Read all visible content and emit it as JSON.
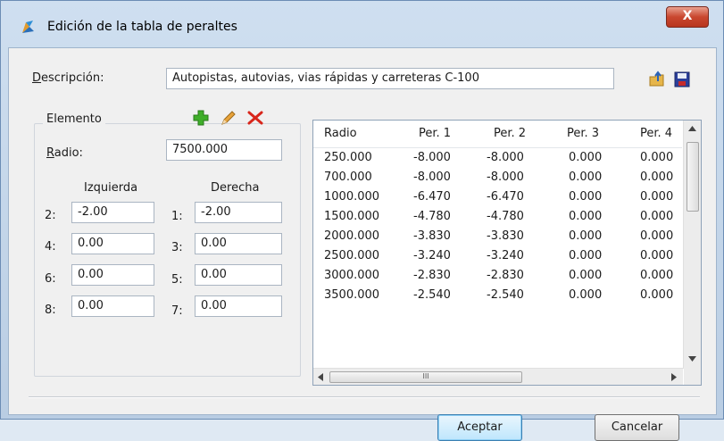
{
  "window": {
    "title": "Edición de la tabla de peraltes",
    "close_label": "X"
  },
  "descripcion": {
    "label_u": "D",
    "label_rest": "escripción:",
    "value": "Autopistas, autovias, vias rápidas y carreteras C-100"
  },
  "elemento": {
    "title": "Elemento",
    "radio_label_u": "R",
    "radio_label_rest": "adio:",
    "radio_value": "7500.000",
    "izquierda_label": "Izquierda",
    "derecha_label": "Derecha",
    "left": [
      {
        "label": "2:",
        "value": "-2.00"
      },
      {
        "label": "4:",
        "value": "0.00"
      },
      {
        "label": "6:",
        "value": "0.00"
      },
      {
        "label": "8:",
        "value": "0.00"
      }
    ],
    "right": [
      {
        "label": "1:",
        "value": "-2.00"
      },
      {
        "label": "3:",
        "value": "0.00"
      },
      {
        "label": "5:",
        "value": "0.00"
      },
      {
        "label": "7:",
        "value": "0.00"
      }
    ]
  },
  "table": {
    "headers": [
      "Radio",
      "Per. 1",
      "Per. 2",
      "Per. 3",
      "Per. 4"
    ],
    "rows": [
      [
        "250.000",
        "-8.000",
        "-8.000",
        "0.000",
        "0.000"
      ],
      [
        "700.000",
        "-8.000",
        "-8.000",
        "0.000",
        "0.000"
      ],
      [
        "1000.000",
        "-6.470",
        "-6.470",
        "0.000",
        "0.000"
      ],
      [
        "1500.000",
        "-4.780",
        "-4.780",
        "0.000",
        "0.000"
      ],
      [
        "2000.000",
        "-3.830",
        "-3.830",
        "0.000",
        "0.000"
      ],
      [
        "2500.000",
        "-3.240",
        "-3.240",
        "0.000",
        "0.000"
      ],
      [
        "3000.000",
        "-2.830",
        "-2.830",
        "0.000",
        "0.000"
      ],
      [
        "3500.000",
        "-2.540",
        "-2.540",
        "0.000",
        "0.000"
      ]
    ],
    "hscroll_grip": "III"
  },
  "buttons": {
    "accept": "Aceptar",
    "cancel": "Cancelar"
  },
  "icons": {
    "app": "app-logo-icon",
    "load": "open-folder-icon",
    "save": "save-disk-icon",
    "add": "add-plus-icon",
    "edit": "edit-pencil-icon",
    "delete": "delete-x-icon"
  },
  "colors": {
    "add": "#3fae2a",
    "delete": "#d8261b",
    "edit": "#e8a33a"
  }
}
